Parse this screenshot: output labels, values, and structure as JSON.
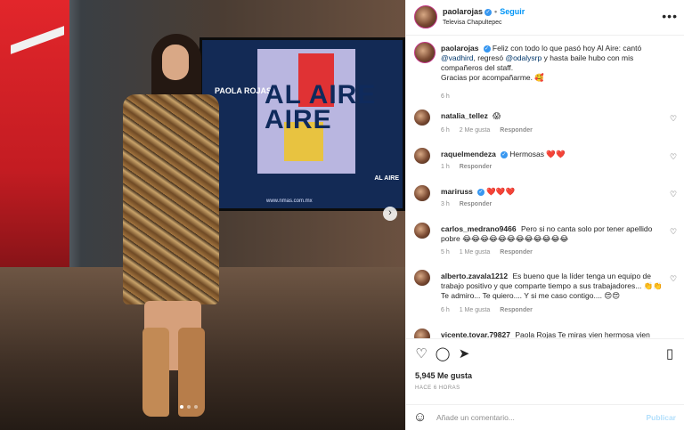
{
  "post": {
    "screen_subtitle": "PAOLA ROJAS",
    "screen_title_1": "AL AIRE",
    "screen_title_2": "AIRE",
    "screen_url": "www.nmas.com.mx",
    "screen_aire_small": "AL AIRE",
    "carousel_dots": 3,
    "active_dot": 1
  },
  "header": {
    "username": "paolarojas",
    "separator": "•",
    "follow_label": "Seguir",
    "location": "Televisa Chapultepec",
    "more_icon": "ellipsis-icon"
  },
  "caption": {
    "username": "paolarojas",
    "text_1": "Feliz con todo lo que pasó hoy Al Aire: cantó",
    "mention_1": "@vadhird",
    "text_2": ", regresó",
    "mention_2": "@odalysrp",
    "text_3": "y hasta baile hubo con mis compañeros del staff.",
    "text_4": "Gracias por acompañarme.",
    "emoji": "🥰",
    "time": "6 h"
  },
  "comments": [
    {
      "username": "natalia_tellez",
      "text": "",
      "emoji": "😱",
      "time": "6 h",
      "likes": "2 Me gusta",
      "reply": "Responder"
    },
    {
      "username": "raquelmendeza",
      "text": "Hermosas",
      "emoji": "❤️❤️",
      "time": "1 h",
      "likes": "",
      "reply": "Responder"
    },
    {
      "username": "mariruss",
      "text": "",
      "emoji": "❤️❤️❤️",
      "time": "3 h",
      "likes": "",
      "reply": "Responder"
    },
    {
      "username": "carlos_medrano9466",
      "text": "Pero si no canta solo por tener apellido pobre",
      "emoji": "😂😂😂😂😂😂😂😂😂😂😂😂",
      "time": "5 h",
      "likes": "1 Me gusta",
      "reply": "Responder"
    },
    {
      "username": "alberto.zavala1212",
      "text": "Es bueno que la líder tenga un equipo de trabajo positivo y que comparte tiempo a sus trabajadores... 👏👏Te admiro... Te quiero.... Y si me caso contigo....",
      "emoji": "😍😍",
      "time": "6 h",
      "likes": "1 Me gusta",
      "reply": "Responder"
    },
    {
      "username": "vicente.tovar.79827",
      "text": "Paola Rojas Te miras vien hermosa vien",
      "emoji": "",
      "time": "",
      "likes": "",
      "reply": ""
    }
  ],
  "actions": {
    "likes": "5,945 Me gusta",
    "time": "HACE 6 HORAS"
  },
  "add_comment": {
    "placeholder": "Añade un comentario...",
    "publish_label": "Publicar"
  }
}
